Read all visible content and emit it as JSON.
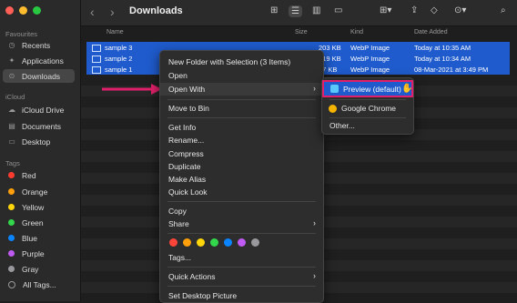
{
  "window": {
    "title": "Downloads"
  },
  "sidebar": {
    "favourites_label": "Favourites",
    "items": [
      {
        "label": "Recents",
        "icon": "clock-icon"
      },
      {
        "label": "Applications",
        "icon": "applications-icon"
      },
      {
        "label": "Downloads",
        "icon": "downloads-icon",
        "selected": true
      }
    ],
    "icloud_label": "iCloud",
    "icloud_items": [
      {
        "label": "iCloud Drive",
        "icon": "cloud-icon"
      },
      {
        "label": "Documents",
        "icon": "document-icon"
      },
      {
        "label": "Desktop",
        "icon": "desktop-icon"
      }
    ],
    "tags_label": "Tags",
    "tags": [
      {
        "label": "Red",
        "color": "#ff3b30"
      },
      {
        "label": "Orange",
        "color": "#ff9f0a"
      },
      {
        "label": "Yellow",
        "color": "#ffd60a"
      },
      {
        "label": "Green",
        "color": "#32d74b"
      },
      {
        "label": "Blue",
        "color": "#0a84ff"
      },
      {
        "label": "Purple",
        "color": "#bf5af2"
      },
      {
        "label": "Gray",
        "color": "#98989d"
      },
      {
        "label": "All Tags...",
        "color": ""
      }
    ]
  },
  "columns": {
    "name": "Name",
    "size": "Size",
    "kind": "Kind",
    "date": "Date Added"
  },
  "files": [
    {
      "name": "sample 3",
      "size": "203 KB",
      "kind": "WebP Image",
      "date": "Today at 10:35 AM"
    },
    {
      "name": "sample 2",
      "size": "219 KB",
      "kind": "WebP Image",
      "date": "Today at 10:34 AM"
    },
    {
      "name": "sample 1",
      "size": "77 KB",
      "kind": "WebP Image",
      "date": "08-Mar-2021 at 3:49 PM"
    }
  ],
  "context_menu": {
    "new_folder": "New Folder with Selection (3 Items)",
    "open": "Open",
    "open_with": "Open With",
    "move_to_bin": "Move to Bin",
    "get_info": "Get Info",
    "rename": "Rename...",
    "compress": "Compress",
    "duplicate": "Duplicate",
    "make_alias": "Make Alias",
    "quick_look": "Quick Look",
    "copy": "Copy",
    "share": "Share",
    "tags": "Tags...",
    "quick_actions": "Quick Actions",
    "set_desktop_picture": "Set Desktop Picture",
    "tag_colors": [
      "#ff453a",
      "#ff9f0a",
      "#ffd60a",
      "#32d74b",
      "#0a84ff",
      "#bf5af2",
      "#98989d"
    ]
  },
  "open_with_menu": {
    "preview": "Preview (default)",
    "chrome": "Google Chrome",
    "other": "Other..."
  },
  "colors": {
    "accent": "#1f5bcc",
    "highlight_border": "#e0206a",
    "arrow": "#e0206a"
  }
}
